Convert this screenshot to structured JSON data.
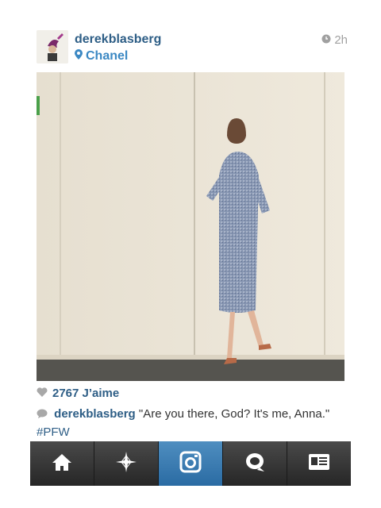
{
  "post": {
    "username": "derekblasberg",
    "location": "Chanel",
    "time": "2h",
    "avatar_icon": "user-avatar",
    "location_icon": "pin-icon",
    "time_icon": "clock-icon"
  },
  "likes": {
    "count_text": "2767 J’aime",
    "icon": "heart-icon"
  },
  "caption": {
    "username": "derekblasberg",
    "text": "\"Are you there, God? It's me, Anna.\"",
    "hashtag": "#PFW",
    "icon": "comment-icon"
  },
  "tabbar": {
    "tabs": [
      {
        "icon": "home-icon",
        "active": false
      },
      {
        "icon": "explore-star-icon",
        "active": false
      },
      {
        "icon": "camera-icon",
        "active": true
      },
      {
        "icon": "news-speech-icon",
        "active": false
      },
      {
        "icon": "profile-card-icon",
        "active": false
      }
    ]
  },
  "colors": {
    "username": "#2e5e86",
    "location": "#3b88c3",
    "tab_active": "#3f7fb5",
    "tab_bg": "#2b2b2b"
  }
}
